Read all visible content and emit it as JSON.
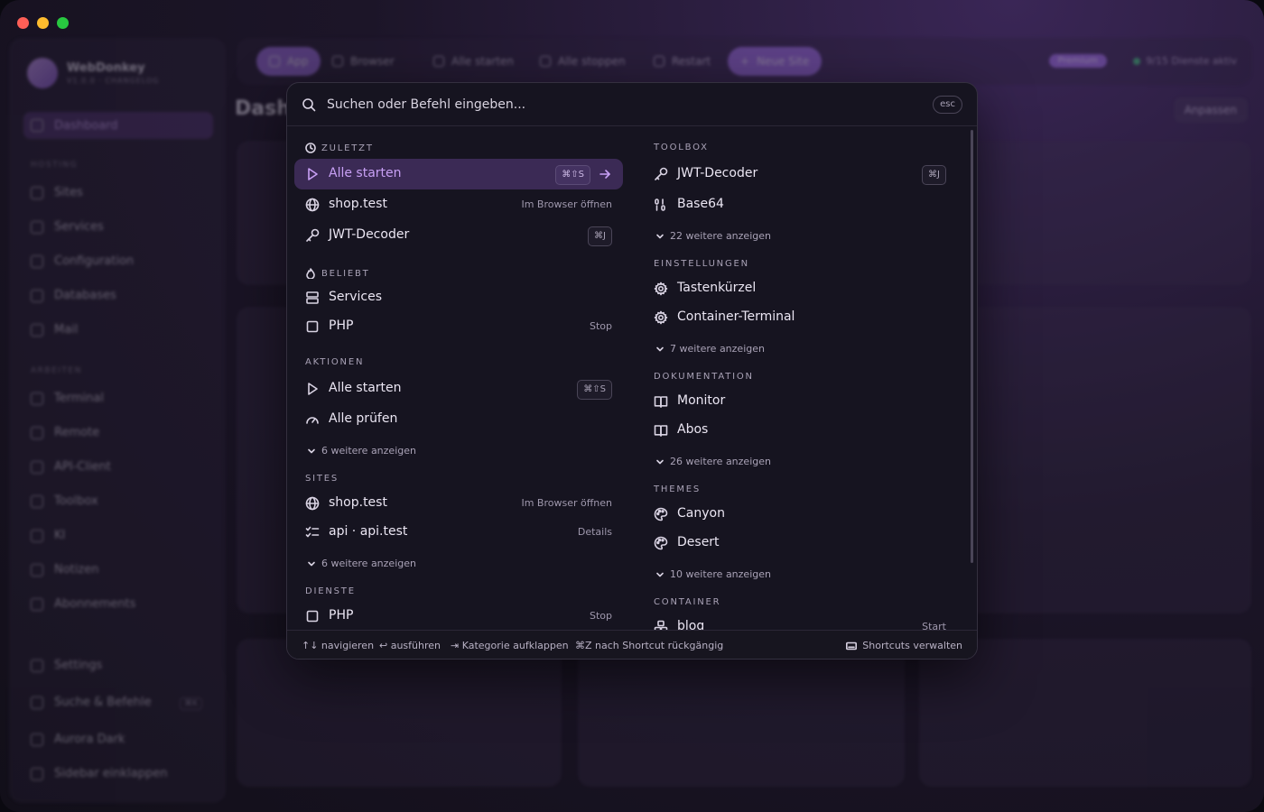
{
  "app": {
    "name": "WebDonkey",
    "version": "V1.0.0 · CHANGELOG"
  },
  "sidebar": {
    "dashboard": "Dashboard",
    "section_hosting": "HOSTING",
    "hosting": [
      "Sites",
      "Services",
      "Configuration",
      "Databases",
      "Mail"
    ],
    "section_arbeiten": "ARBEITEN",
    "arbeiten": [
      "Terminal",
      "Remote",
      "API-Client",
      "Toolbox",
      "KI",
      "Notizen",
      "Abonnements"
    ],
    "bottom": [
      "Settings",
      "Suche & Befehle",
      "Aurora Dark",
      "Sidebar einklappen"
    ],
    "search_kbd": "⌘K"
  },
  "topbar": {
    "app": "App",
    "browser": "Browser",
    "alle_starten": "Alle starten",
    "alle_stoppen": "Alle stoppen",
    "restart": "Restart",
    "neue_site": "Neue Site",
    "premium": "Premium",
    "dienste_status": "9/15 Dienste aktiv"
  },
  "page": {
    "title": "Dashboard",
    "anpassen": "Anpassen"
  },
  "palette": {
    "search_placeholder": "Suchen oder Befehl eingeben...",
    "esc": "esc",
    "left": {
      "zuletzt": {
        "title": "ZULETZT",
        "items": [
          {
            "label": "Alle starten",
            "kbd": "⌘⇧S"
          },
          {
            "label": "shop.test",
            "hint": "Im Browser öffnen"
          },
          {
            "label": "JWT-Decoder",
            "kbd": "⌘J"
          }
        ]
      },
      "beliebt": {
        "title": "BELIEBT",
        "items": [
          {
            "label": "Services"
          },
          {
            "label": "PHP",
            "hint": "Stop"
          }
        ]
      },
      "aktionen": {
        "title": "AKTIONEN",
        "items": [
          {
            "label": "Alle starten",
            "kbd": "⌘⇧S"
          },
          {
            "label": "Alle prüfen"
          }
        ],
        "more": "6 weitere anzeigen"
      },
      "sites": {
        "title": "SITES",
        "items": [
          {
            "label": "shop.test",
            "hint": "Im Browser öffnen"
          },
          {
            "label": "api · api.test",
            "hint": "Details"
          }
        ],
        "more": "6 weitere anzeigen"
      },
      "dienste": {
        "title": "DIENSTE",
        "items": [
          {
            "label": "PHP",
            "hint": "Stop"
          }
        ]
      }
    },
    "right": {
      "toolbox": {
        "title": "TOOLBOX",
        "items": [
          {
            "label": "JWT-Decoder",
            "kbd": "⌘J"
          },
          {
            "label": "Base64"
          }
        ],
        "more": "22 weitere anzeigen"
      },
      "einstellungen": {
        "title": "EINSTELLUNGEN",
        "items": [
          {
            "label": "Tastenkürzel"
          },
          {
            "label": "Container-Terminal"
          }
        ],
        "more": "7 weitere anzeigen"
      },
      "dokumentation": {
        "title": "DOKUMENTATION",
        "items": [
          {
            "label": "Monitor"
          },
          {
            "label": "Abos"
          }
        ],
        "more": "26 weitere anzeigen"
      },
      "themes": {
        "title": "THEMES",
        "items": [
          {
            "label": "Canyon"
          },
          {
            "label": "Desert"
          }
        ],
        "more": "10 weitere anzeigen"
      },
      "container": {
        "title": "CONTAINER",
        "items": [
          {
            "label": "blog",
            "hint": "Start"
          }
        ]
      }
    },
    "footer": {
      "navigieren": "↑↓ navigieren",
      "ausfuehren": "↩ ausführen",
      "kategorie": "⇥ Kategorie aufklappen",
      "rueckgaengig": "⌘Z nach Shortcut rückgängig",
      "shortcuts": "Shortcuts verwalten"
    }
  },
  "colors": {
    "accent": "#9c6ee0",
    "selected_row": "#3b2a55",
    "palette_bg": "#161420"
  }
}
